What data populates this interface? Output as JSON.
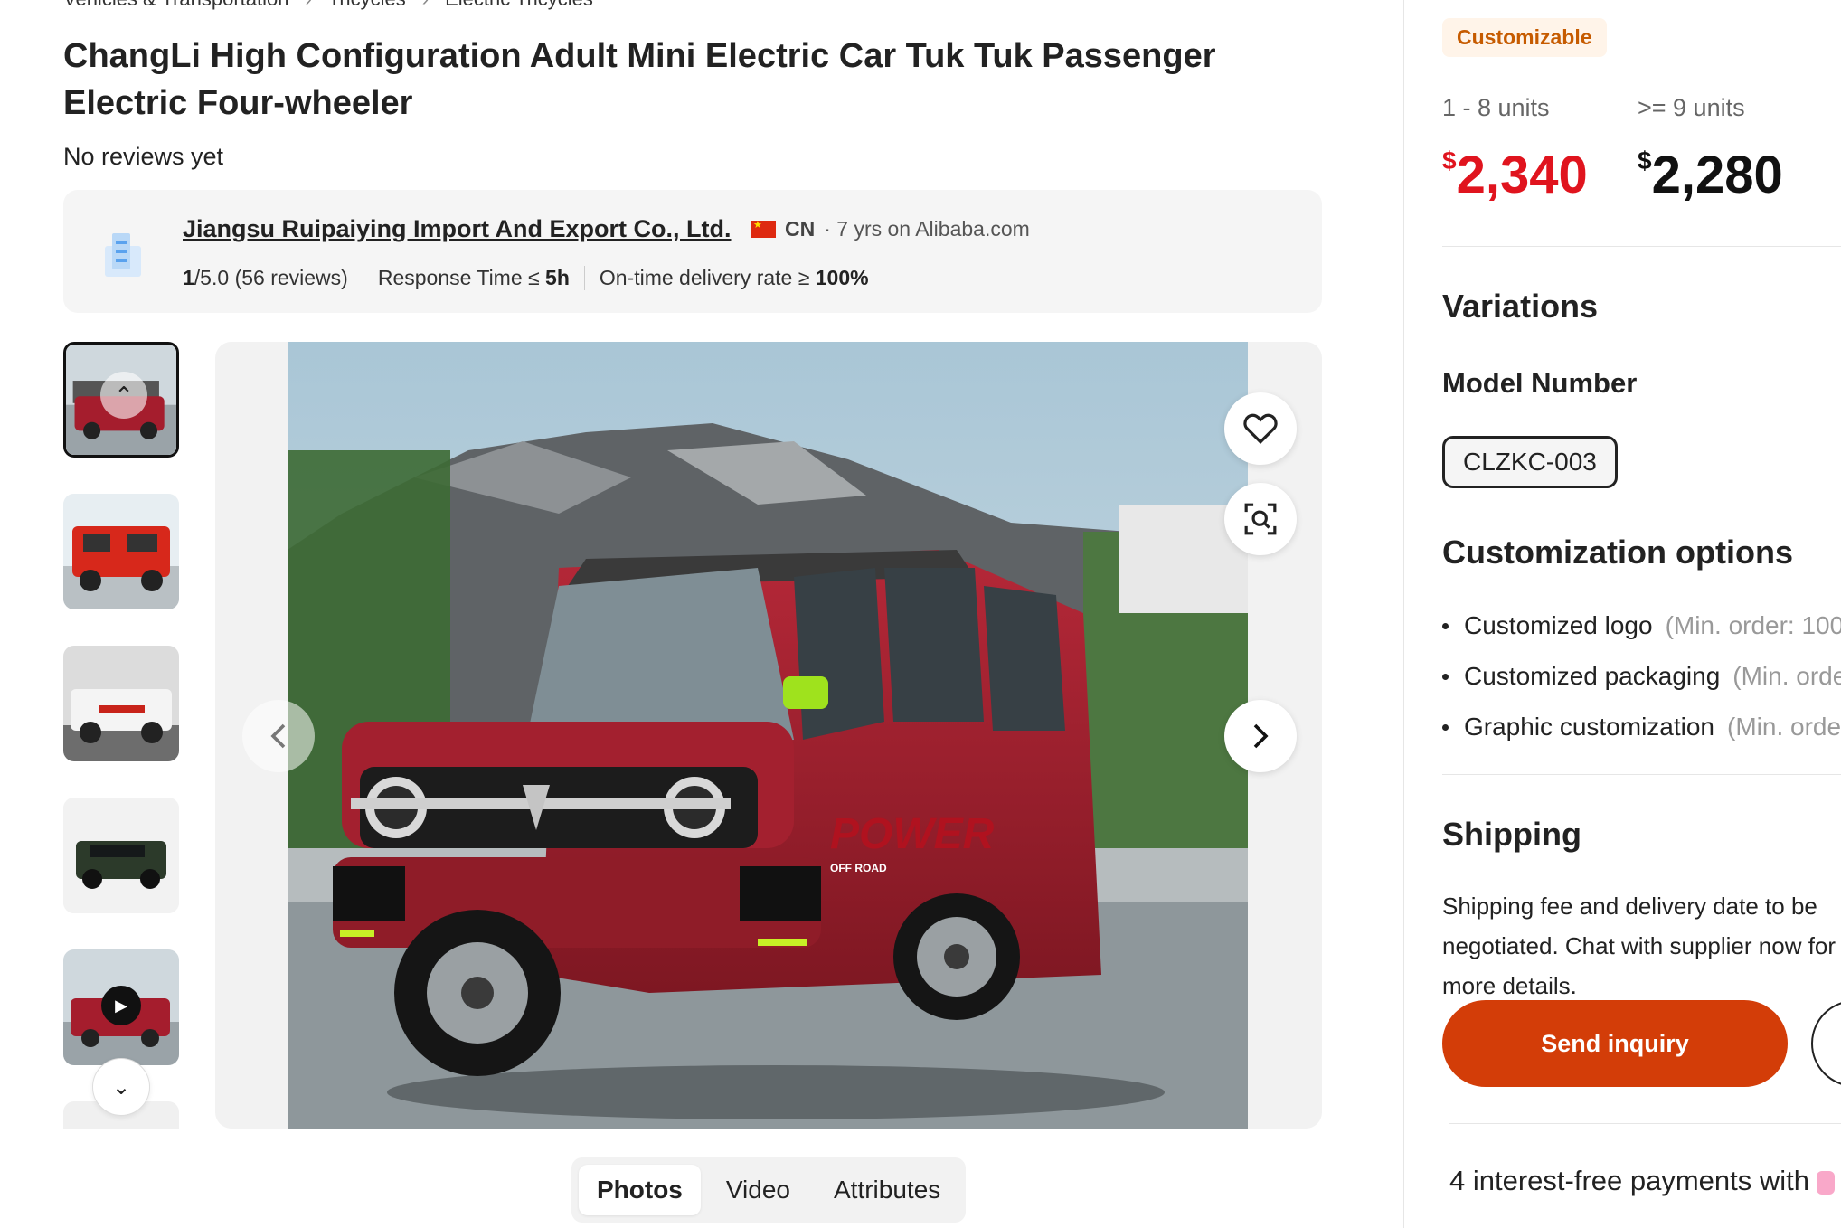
{
  "breadcrumb": [
    "Vehicles & Transportation",
    "Tricycles",
    "Electric Tricycles"
  ],
  "product": {
    "title": "ChangLi High Configuration Adult Mini Electric Car Tuk Tuk Passenger Electric Four-wheeler",
    "reviews": "No reviews yet"
  },
  "supplier": {
    "name": "Jiangsu Ruipaiying Import And Export Co., Ltd.",
    "country": "CN",
    "tenure": "· 7 yrs on Alibaba.com",
    "rating_value": "1",
    "rating_scale": "/5.0",
    "rating_count": "(56 reviews)",
    "response_label": "Response Time ≤ ",
    "response_value": "5h",
    "delivery_label": "On-time delivery rate ≥ ",
    "delivery_value": "100%"
  },
  "gallery": {
    "thumbnails": [
      "red-car-front",
      "red-car-side",
      "white-car-side",
      "green-car",
      "red-car-video"
    ],
    "selected_index": 0,
    "tabs": [
      "Photos",
      "Video",
      "Attributes"
    ],
    "active_tab": "Photos",
    "photo_text": {
      "brand": "POWER",
      "sub": "OFF ROAD"
    }
  },
  "pricing": {
    "badge": "Customizable",
    "tiers": [
      {
        "label": "1 - 8 units",
        "currency": "$",
        "amount": "2,340",
        "color": "#e0141e"
      },
      {
        "label": ">= 9 units",
        "currency": "$",
        "amount": "2,280",
        "color": "#111111"
      }
    ]
  },
  "variations": {
    "heading": "Variations",
    "model_heading": "Model Number",
    "model_selected": "CLZKC-003"
  },
  "customization": {
    "heading": "Customization options",
    "options": [
      {
        "name": "Customized logo",
        "min": "(Min. order: 100"
      },
      {
        "name": "Customized packaging",
        "min": "(Min. orde"
      },
      {
        "name": "Graphic customization",
        "min": "(Min. orde"
      }
    ]
  },
  "shipping": {
    "heading": "Shipping",
    "text": "Shipping fee and delivery date to be negotiated. Chat with supplier now for more details."
  },
  "actions": {
    "inquiry": "Send inquiry"
  },
  "payments": {
    "text": "4 interest-free payments with"
  },
  "colors": {
    "accent": "#d33d08",
    "price_red": "#e0141e",
    "badge_text": "#c65b00",
    "badge_bg": "#fff4e9"
  }
}
